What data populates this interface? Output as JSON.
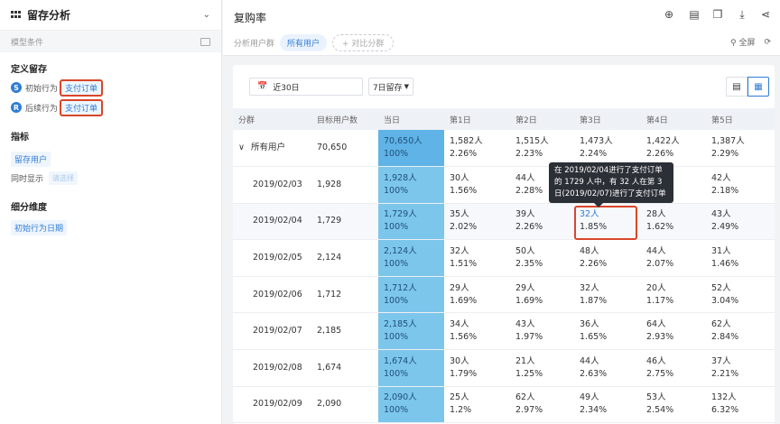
{
  "left": {
    "title": "留存分析",
    "condition_label": "模型条件",
    "define_title": "定义留存",
    "initial": {
      "badge": "S",
      "label": "初始行为",
      "event": "支付订单"
    },
    "followup": {
      "badge": "R",
      "label": "后续行为",
      "event": "支付订单"
    },
    "metric_title": "指标",
    "metric_value": "留存用户",
    "also_show_label": "同时显示",
    "also_show_placeholder": "请选择",
    "dimension_title": "细分维度",
    "dimension_value": "初始行为日期"
  },
  "top": {
    "title": "复购率",
    "segment_label": "分析用户群",
    "segment_active": "所有用户",
    "compare_btn": "+ 对比分群",
    "fullscreen": "全屏"
  },
  "controls": {
    "date_range": "近30日",
    "retention_period": "7日留存"
  },
  "table": {
    "headers": [
      "分群",
      "目标用户数",
      "当日",
      "第1日",
      "第2日",
      "第3日",
      "第4日",
      "第5日"
    ],
    "rows": [
      {
        "seg": "所有用户",
        "target": "70,650",
        "cells": [
          [
            "70,650人",
            "100%"
          ],
          [
            "1,582人",
            "2.26%"
          ],
          [
            "1,515人",
            "2.23%"
          ],
          [
            "1,473人",
            "2.24%"
          ],
          [
            "1,422人",
            "2.26%"
          ],
          [
            "1,387人",
            "2.29%"
          ]
        ]
      },
      {
        "seg": "2019/02/03",
        "target": "1,928",
        "cells": [
          [
            "1,928人",
            "100%"
          ],
          [
            "30人",
            "1.56%"
          ],
          [
            "44人",
            "2.28%"
          ],
          [
            "",
            ""
          ],
          [
            "",
            ""
          ],
          [
            "42人",
            "2.18%"
          ]
        ]
      },
      {
        "seg": "2019/02/04",
        "target": "1,729",
        "cells": [
          [
            "1,729人",
            "100%"
          ],
          [
            "35人",
            "2.02%"
          ],
          [
            "39人",
            "2.26%"
          ],
          [
            "32人",
            "1.85%"
          ],
          [
            "28人",
            "1.62%"
          ],
          [
            "43人",
            "2.49%"
          ]
        ]
      },
      {
        "seg": "2019/02/05",
        "target": "2,124",
        "cells": [
          [
            "2,124人",
            "100%"
          ],
          [
            "32人",
            "1.51%"
          ],
          [
            "50人",
            "2.35%"
          ],
          [
            "48人",
            "2.26%"
          ],
          [
            "44人",
            "2.07%"
          ],
          [
            "31人",
            "1.46%"
          ]
        ]
      },
      {
        "seg": "2019/02/06",
        "target": "1,712",
        "cells": [
          [
            "1,712人",
            "100%"
          ],
          [
            "29人",
            "1.69%"
          ],
          [
            "29人",
            "1.69%"
          ],
          [
            "32人",
            "1.87%"
          ],
          [
            "20人",
            "1.17%"
          ],
          [
            "52人",
            "3.04%"
          ]
        ]
      },
      {
        "seg": "2019/02/07",
        "target": "2,185",
        "cells": [
          [
            "2,185人",
            "100%"
          ],
          [
            "34人",
            "1.56%"
          ],
          [
            "43人",
            "1.97%"
          ],
          [
            "36人",
            "1.65%"
          ],
          [
            "64人",
            "2.93%"
          ],
          [
            "62人",
            "2.84%"
          ]
        ]
      },
      {
        "seg": "2019/02/08",
        "target": "1,674",
        "cells": [
          [
            "1,674人",
            "100%"
          ],
          [
            "30人",
            "1.79%"
          ],
          [
            "21人",
            "1.25%"
          ],
          [
            "44人",
            "2.63%"
          ],
          [
            "46人",
            "2.75%"
          ],
          [
            "37人",
            "2.21%"
          ]
        ]
      },
      {
        "seg": "2019/02/09",
        "target": "2,090",
        "cells": [
          [
            "2,090人",
            "100%"
          ],
          [
            "25人",
            "1.2%"
          ],
          [
            "62人",
            "2.97%"
          ],
          [
            "49人",
            "2.34%"
          ],
          [
            "53人",
            "2.54%"
          ],
          [
            "132人",
            "6.32%"
          ]
        ]
      }
    ]
  },
  "tooltip": {
    "line1": "在 2019/02/04进行了支付订单",
    "line2": "的 1729 人中，有 32 人在第 3",
    "line3": "日(2019/02/07)进行了支付订单"
  },
  "colors": {
    "accent": "#2f7cd6",
    "highlight_red": "#d9462a",
    "day0_bg": "#7cc6ec"
  }
}
